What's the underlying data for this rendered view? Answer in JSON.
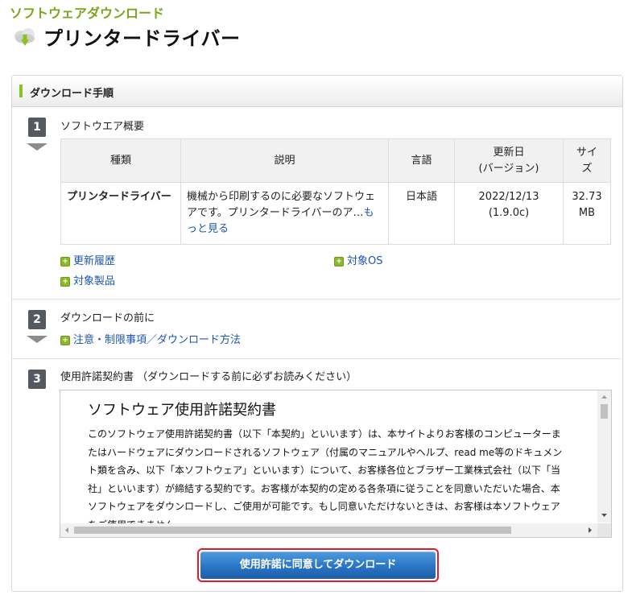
{
  "header": {
    "category": "ソフトウェアダウンロード",
    "title": "プリンタードライバー"
  },
  "panel": {
    "heading": "ダウンロード手順"
  },
  "steps": [
    {
      "number": "1",
      "label": "ソフトウエア概要",
      "table": {
        "headers": [
          "種類",
          "説明",
          "言語",
          "更新日\n(バージョン)",
          "サイ\nズ"
        ],
        "row": {
          "type": "プリンタードライバー",
          "description": "機械から印刷するのに必要なソフトウェアです。プリンタードライバーのア…",
          "more_link": "もっと見る",
          "language": "日本語",
          "updated": "2022/12/13\n(1.9.0c)",
          "size": "32.73\nMB"
        }
      },
      "links": [
        "更新履歴",
        "対象OS",
        "対象製品"
      ]
    },
    {
      "number": "2",
      "label": "ダウンロードの前に",
      "links": [
        "注意・制限事項／ダウンロード方法"
      ]
    },
    {
      "number": "3",
      "label": "使用許諾契約書 （ダウンロードする前に必ずお読みください）"
    }
  ],
  "license": {
    "title": "ソフトウェア使用許諾契約書",
    "body": "このソフトウェア使用許諾契約書（以下「本契約」といいます）は、本サイトよりお客様のコンピューターまたはハードウェアにダウンロードされるソフトウェア（付属のマニュアルやヘルプ、read me等のドキュメント類を含み、以下「本ソフトウェア」といいます）について、お客様各位とブラザー工業株式会社（以下「当社」といいます）が締結する契約です。お客様が本契約の定める各条項に従うことを同意いただいた場合、本ソフトウェアをダウンロードし、ご使用が可能です。もし同意いただけないときは、お客様は本ソフトウェアをご使用できません。"
  },
  "download_button": {
    "label": "使用許諾に同意してダウンロード"
  },
  "colors": {
    "accent_green": "#7aa51c",
    "link_blue": "#1a55b3",
    "button_blue": "#2a75c6",
    "highlight_red": "#e0192c"
  }
}
